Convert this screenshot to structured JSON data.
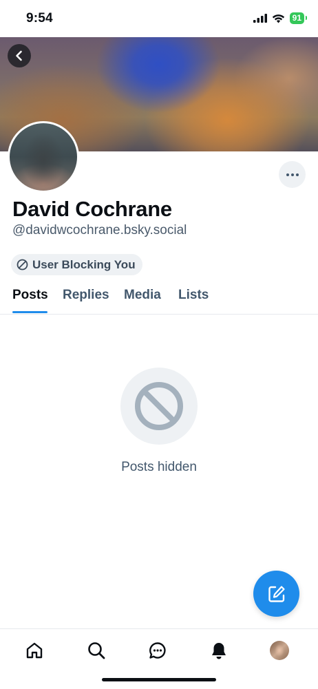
{
  "status_bar": {
    "time": "9:54",
    "battery": "91"
  },
  "profile": {
    "display_name": "David Cochrane",
    "handle": "@davidwcochrane.bsky.social",
    "blocking_label": "User Blocking You"
  },
  "tabs": [
    {
      "label": "Posts",
      "active": true
    },
    {
      "label": "Replies",
      "active": false
    },
    {
      "label": "Media",
      "active": false
    },
    {
      "label": "Lists",
      "active": false
    }
  ],
  "empty_state": {
    "text": "Posts hidden",
    "icon": "ban-icon"
  },
  "bottom_nav": {
    "items": [
      "home-icon",
      "search-icon",
      "chat-icon",
      "bell-icon",
      "avatar"
    ]
  },
  "colors": {
    "accent": "#1f8ceb",
    "muted_text": "#42576c",
    "pill_bg": "#eef1f4"
  }
}
